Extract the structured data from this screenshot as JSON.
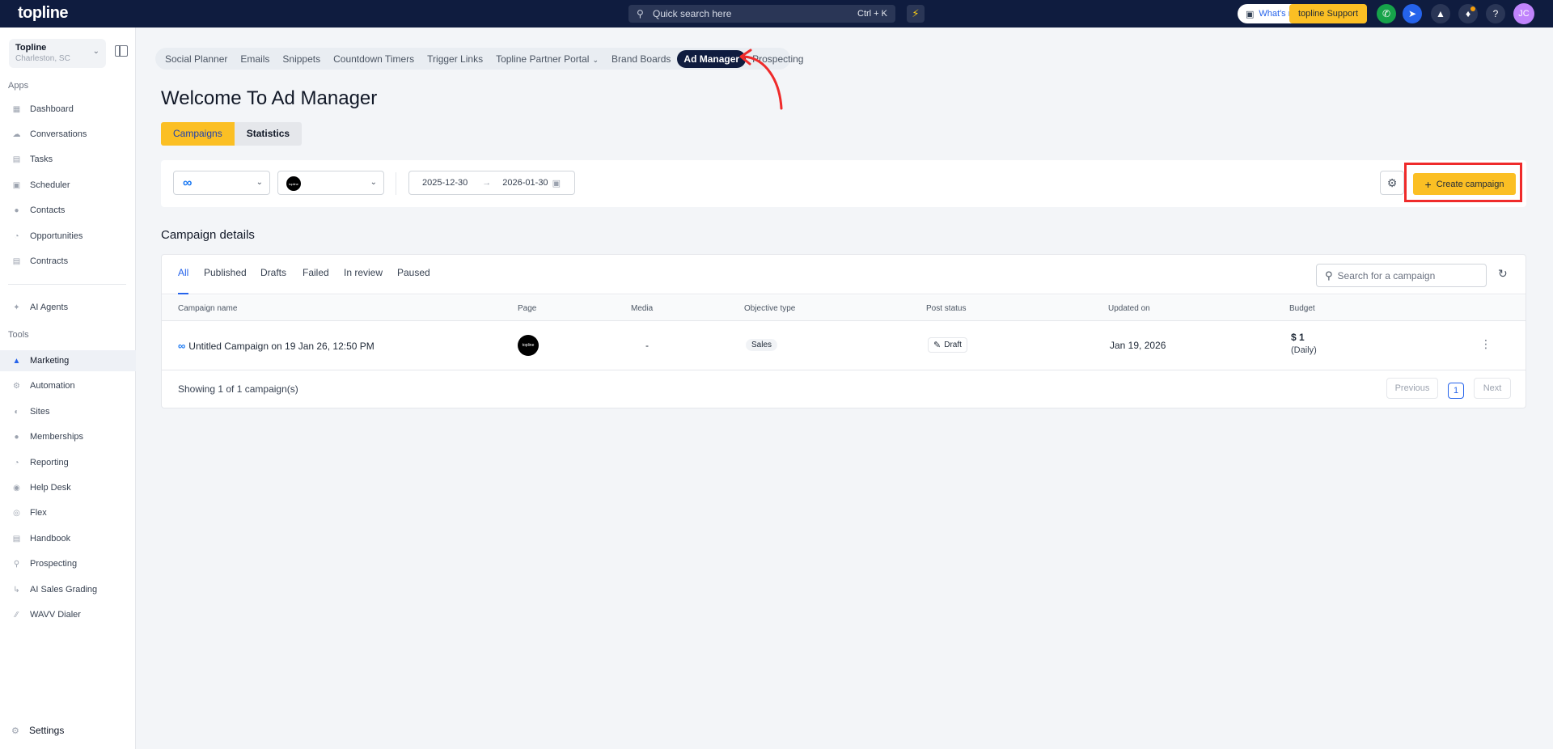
{
  "topbar": {
    "logo": "topline",
    "search_placeholder": "Quick search here",
    "search_shortcut": "Ctrl + K",
    "whats_new": "What's new",
    "support": "topline Support",
    "avatar_initials": "JC"
  },
  "sidebar": {
    "account_name": "Topline",
    "account_location": "Charleston, SC",
    "apps_label": "Apps",
    "apps": [
      {
        "label": "Dashboard",
        "icon": "dashboard-icon"
      },
      {
        "label": "Conversations",
        "icon": "chat-icon"
      },
      {
        "label": "Tasks",
        "icon": "tasks-icon"
      },
      {
        "label": "Scheduler",
        "icon": "calendar-icon"
      },
      {
        "label": "Contacts",
        "icon": "person-icon"
      },
      {
        "label": "Opportunities",
        "icon": "pie-icon"
      },
      {
        "label": "Contracts",
        "icon": "document-icon"
      }
    ],
    "ai_agents": "AI Agents",
    "tools_label": "Tools",
    "tools": [
      {
        "label": "Marketing",
        "icon": "megaphone-icon",
        "active": true
      },
      {
        "label": "Automation",
        "icon": "gears-icon"
      },
      {
        "label": "Sites",
        "icon": "globe-icon"
      },
      {
        "label": "Memberships",
        "icon": "people-icon"
      },
      {
        "label": "Reporting",
        "icon": "chart-pie-icon"
      },
      {
        "label": "Help Desk",
        "icon": "help-icon"
      },
      {
        "label": "Flex",
        "icon": "flex-icon"
      },
      {
        "label": "Handbook",
        "icon": "book-icon"
      },
      {
        "label": "Prospecting",
        "icon": "search-icon"
      },
      {
        "label": "AI Sales Grading",
        "icon": "chart-line-icon"
      },
      {
        "label": "WAVV Dialer",
        "icon": "wavv-icon"
      }
    ],
    "settings": "Settings"
  },
  "top_nav": [
    {
      "label": "Social Planner"
    },
    {
      "label": "Emails"
    },
    {
      "label": "Snippets"
    },
    {
      "label": "Countdown Timers"
    },
    {
      "label": "Trigger Links"
    },
    {
      "label": "Topline Partner Portal",
      "dropdown": true
    },
    {
      "label": "Brand Boards"
    },
    {
      "label": "Ad Manager",
      "active": true
    },
    {
      "label": "Prospecting"
    }
  ],
  "page": {
    "title": "Welcome To Ad Manager",
    "tab_campaigns": "Campaigns",
    "tab_statistics": "Statistics"
  },
  "filters": {
    "page_avatar_text": "topline",
    "date_start": "2025-12-30",
    "date_end": "2026-01-30",
    "create_label": "Create campaign"
  },
  "campaigns": {
    "section_title": "Campaign details",
    "tabs": [
      "All",
      "Published",
      "Drafts",
      "Failed",
      "In review",
      "Paused"
    ],
    "search_placeholder": "Search for a campaign",
    "columns": [
      "Campaign name",
      "Page",
      "Media",
      "Objective type",
      "Post status",
      "Updated on",
      "Budget"
    ],
    "rows": [
      {
        "name": "Untitled Campaign on 19 Jan 26, 12:50 PM",
        "page_avatar": "topline",
        "media": "-",
        "objective": "Sales",
        "status": "Draft",
        "updated": "Jan 19, 2026",
        "budget": "$ 1",
        "budget_period": "(Daily)"
      }
    ],
    "showing": "Showing 1 of 1 campaign(s)",
    "pagination": {
      "prev": "Previous",
      "current": "1",
      "next": "Next"
    }
  },
  "colors": {
    "topbar_bg": "#0f1c3f",
    "accent_yellow": "#fbbf24",
    "link_blue": "#2563eb",
    "highlight_red": "#ef2b2b"
  }
}
